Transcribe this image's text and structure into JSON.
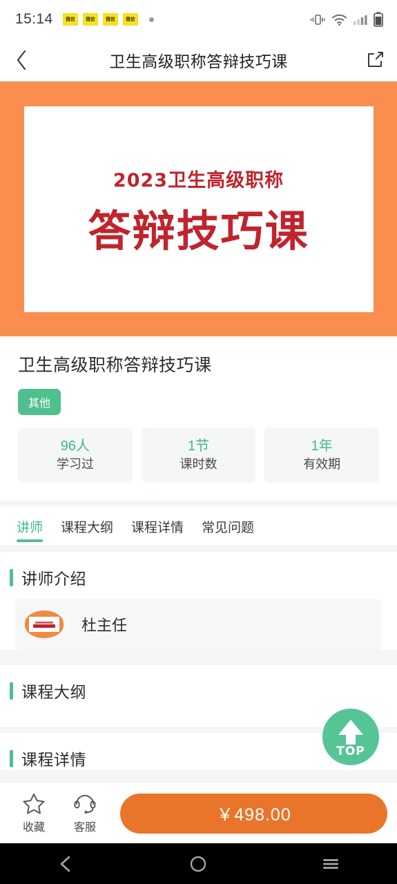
{
  "status_bar": {
    "time": "15:14",
    "notification_badges": [
      "微信",
      "微信",
      "微信",
      "微信"
    ],
    "icons": [
      "vibrate-icon",
      "wifi-icon",
      "signal-icon",
      "battery-icon"
    ]
  },
  "header": {
    "back_icon": "chevron-left-icon",
    "title": "卫生高级职称答辩技巧课",
    "share_icon": "share-icon"
  },
  "banner": {
    "subtitle": "2023卫生高级职称",
    "main_title": "答辩技巧课",
    "bg_color": "#F98E4F",
    "text_color": "#C0242C"
  },
  "course": {
    "title": "卫生高级职称答辩技巧课",
    "tag": "其他",
    "tag_color": "#4FC08D",
    "stats": [
      {
        "value": "96人",
        "label": "学习过"
      },
      {
        "value": "1节",
        "label": "课时数"
      },
      {
        "value": "1年",
        "label": "有效期"
      }
    ]
  },
  "tabs": [
    {
      "label": "讲师",
      "active": true
    },
    {
      "label": "课程大纲",
      "active": false
    },
    {
      "label": "课程详情",
      "active": false
    },
    {
      "label": "常见问题",
      "active": false
    }
  ],
  "sections": [
    {
      "title": "讲师介绍"
    },
    {
      "title": "课程大纲"
    },
    {
      "title": "课程详情"
    }
  ],
  "teacher": {
    "name": "杜主任",
    "avatar_icon": "course-thumbnail-avatar"
  },
  "scroll_top_button": {
    "label": "TOP",
    "icon": "arrow-up-icon",
    "color": "#56C596"
  },
  "bottom_bar": {
    "favorite": {
      "label": "收藏",
      "icon": "star-outline-icon"
    },
    "support": {
      "label": "客服",
      "icon": "headset-icon"
    },
    "buy_button": {
      "label": "￥498.00",
      "color": "#E8752A"
    }
  },
  "android_nav": {
    "back_icon": "nav-back-icon",
    "home_icon": "nav-home-circle-icon",
    "recents_icon": "nav-recents-icon"
  },
  "theme": {
    "accent_green": "#4FC08D",
    "accent_orange": "#E8752A",
    "page_bg": "#F5F5F5"
  }
}
